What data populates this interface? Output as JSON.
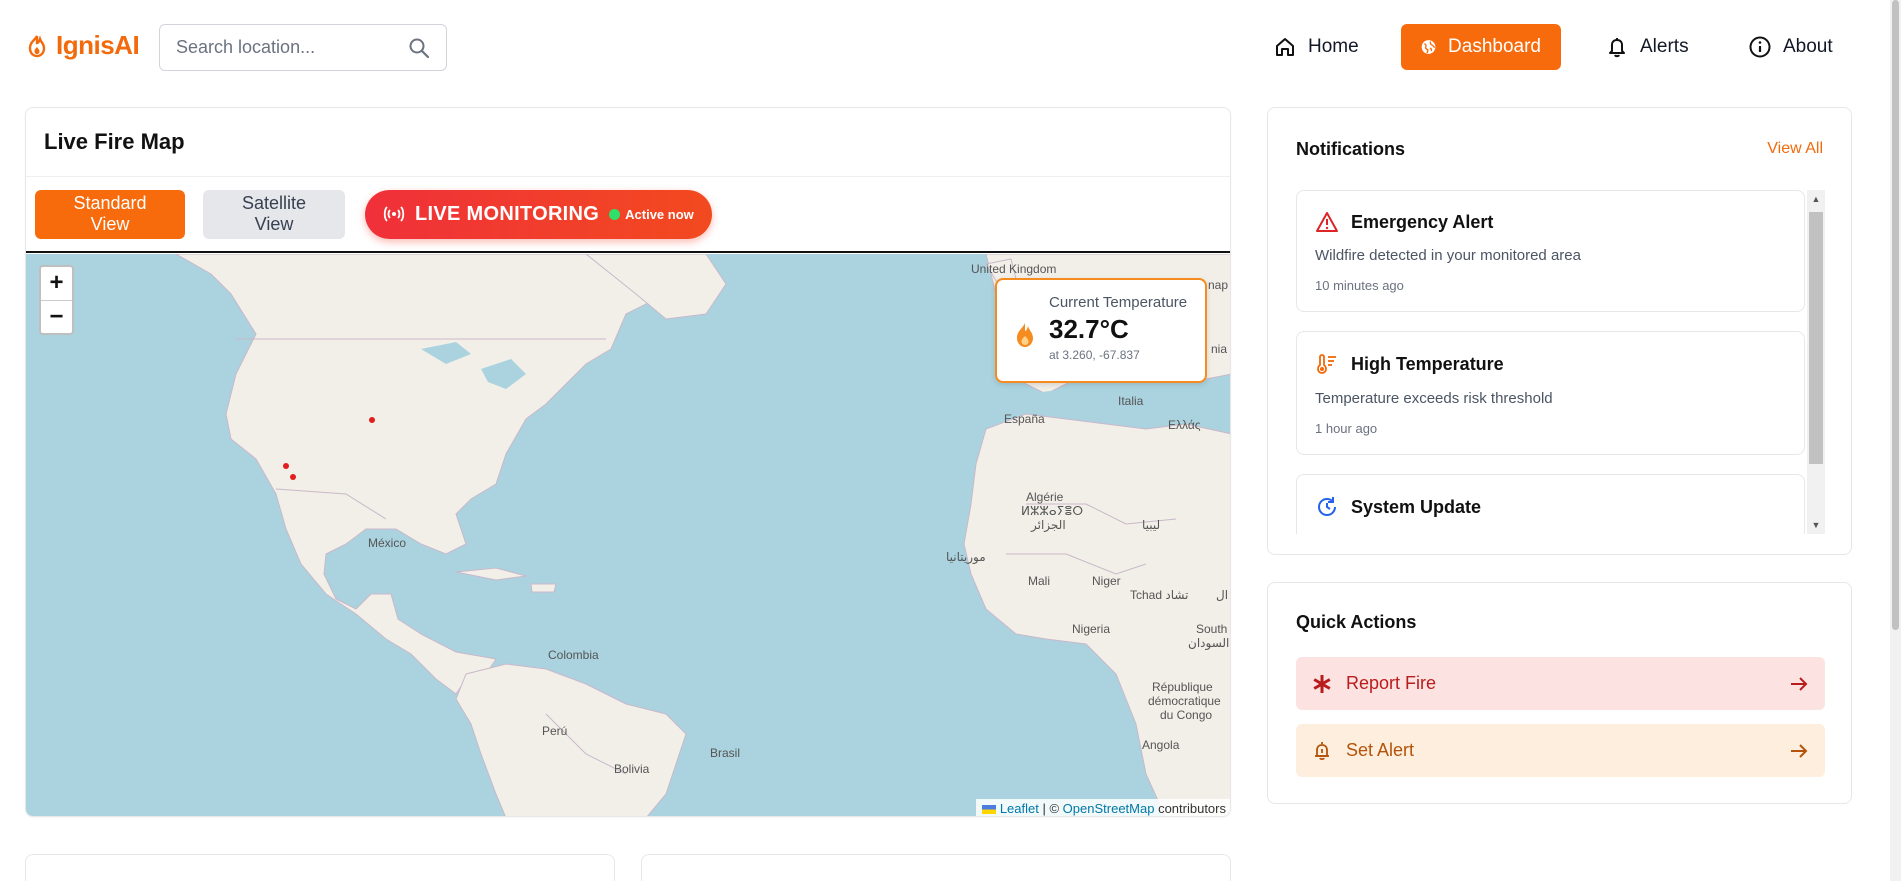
{
  "app": {
    "name": "IgnisAI",
    "brand_color": "#f76b0d"
  },
  "search": {
    "placeholder": "Search location..."
  },
  "nav": {
    "home": "Home",
    "dashboard": "Dashboard",
    "alerts": "Alerts",
    "about": "About",
    "active": "Dashboard"
  },
  "map": {
    "title": "Live Fire Map",
    "standard_view": "Standard View",
    "satellite_view": "Satellite View",
    "live_label": "LIVE MONITORING",
    "live_status": "Active now",
    "zoom_in": "+",
    "zoom_out": "−",
    "temperature": {
      "label": "Current Temperature",
      "value": "32.7°C",
      "coords": "at 3.260, -67.837"
    },
    "attribution": {
      "leaflet": "Leaflet",
      "separator": " | © ",
      "osm": "OpenStreetMap",
      "suffix": " contributors"
    },
    "place_labels": [
      "United Kingdom",
      "España",
      "Italia",
      "Ελλάς",
      "Algérie",
      "ⵍⵣⵣⴰⵢⴻⵔ",
      "الجزائر",
      "ليبيا",
      "México",
      "Mali",
      "Niger",
      "Tchad تشاد",
      "موريتانيا",
      "Nigeria",
      "South",
      "السودان",
      "Colombia",
      "Perú",
      "Brasil",
      "Bolivia",
      "République",
      "démocratique",
      "du Congo",
      "Angola",
      "nap",
      "nia",
      "ال"
    ]
  },
  "notifications": {
    "title": "Notifications",
    "view_all": "View All",
    "items": [
      {
        "icon": "warning-triangle-icon",
        "title": "Emergency Alert",
        "body": "Wildfire detected in your monitored area",
        "time": "10 minutes ago",
        "color": "#dc2626"
      },
      {
        "icon": "thermometer-icon",
        "title": "High Temperature",
        "body": "Temperature exceeds risk threshold",
        "time": "1 hour ago",
        "color": "#f26a0c"
      },
      {
        "icon": "refresh-icon",
        "title": "System Update",
        "body": "",
        "time": "",
        "color": "#2563eb"
      }
    ]
  },
  "quick_actions": {
    "title": "Quick Actions",
    "report_fire": "Report Fire",
    "set_alert": "Set Alert"
  }
}
